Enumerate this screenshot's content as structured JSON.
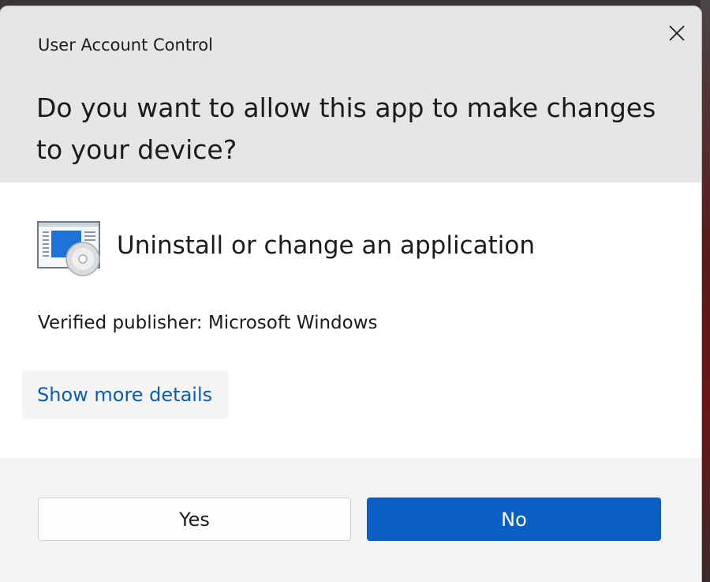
{
  "dialog": {
    "title": "User Account Control",
    "question": "Do you want to allow this app to make changes to your device?",
    "close_icon": "close-icon"
  },
  "app": {
    "icon": "programs-and-features-icon",
    "name": "Uninstall or change an application",
    "publisher": "Verified publisher: Microsoft Windows"
  },
  "details": {
    "label": "Show more details"
  },
  "buttons": {
    "yes_label": "Yes",
    "no_label": "No"
  },
  "colors": {
    "header_bg": "#e6e6e6",
    "footer_bg": "#f3f3f3",
    "link": "#0b5cad",
    "primary_button": "#0a5fc4"
  }
}
